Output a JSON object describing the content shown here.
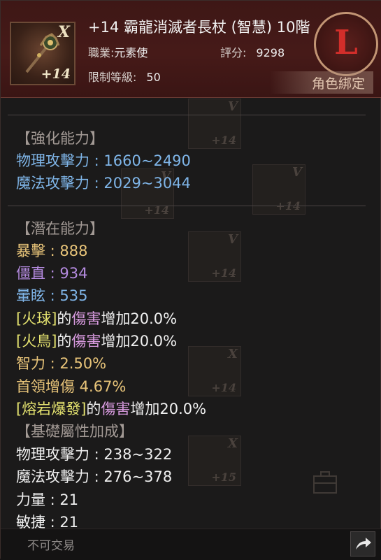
{
  "item": {
    "title": "+14 霸龍消滅者長杖 (智慧) 10階",
    "icon_x": "X",
    "icon_plus": "+14",
    "class_label": "職業:",
    "class_value": "元素使",
    "score_label": "評分:",
    "score_value": "9298",
    "level_label": "限制等級:",
    "level_value": "50",
    "emblem_letter": "L",
    "bind_label": "角色綁定"
  },
  "enhance": {
    "header": "【強化能力】",
    "phys": "物理攻擊力 : 1660~2490",
    "magic": "魔法攻擊力 : 2029~3044"
  },
  "potential": {
    "header": "【潛在能力】",
    "crit": "暴擊 : 888",
    "stiff": "僵直 : 934",
    "stun": "暈眩 : 535",
    "fireball_skill": "[火球]",
    "fireball_of": "的",
    "fireball_dmg": "傷害",
    "fireball_inc": "增加20.0%",
    "firebird_skill": "[火鳥]",
    "firebird_of": "的",
    "firebird_dmg": "傷害",
    "firebird_inc": "增加20.0%",
    "int": "智力 : 2.50%",
    "boss": "首領增傷 4.67%",
    "lava_skill": "[熔岩爆發]",
    "lava_of": "的",
    "lava_dmg": "傷害",
    "lava_inc": "增加20.0%"
  },
  "base": {
    "header": "【基礎屬性加成】",
    "phys": "物理攻擊力 : 238~322",
    "magic": "魔法攻擊力 : 276~378",
    "str": "力量 : 21",
    "agi": "敏捷 : 21"
  },
  "ghost_icons": {
    "v": "V",
    "x": "X",
    "p14": "+14",
    "p15": "+15"
  },
  "footer": {
    "trade": "不可交易"
  },
  "colors": {
    "blue": "#7fb5e8",
    "gold": "#e8c479",
    "purple": "#b58be0",
    "yellow": "#e4e26f",
    "pink": "#d99be0",
    "header_bg": "#461a18"
  }
}
